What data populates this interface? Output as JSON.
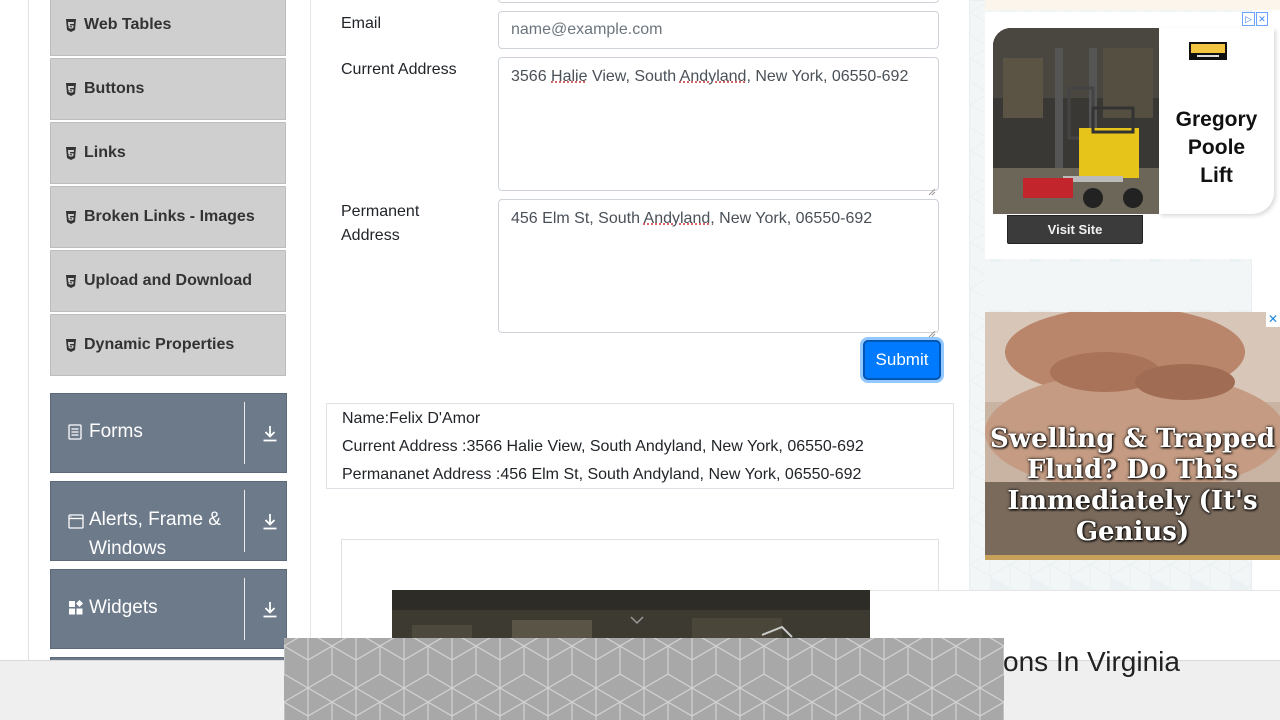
{
  "sidebar": {
    "elements_items": [
      {
        "label": "Web Tables"
      },
      {
        "label": "Buttons"
      },
      {
        "label": "Links"
      },
      {
        "label": "Broken Links - Images"
      },
      {
        "label": "Upload and Download"
      },
      {
        "label": "Dynamic Properties"
      }
    ],
    "groups": [
      {
        "label": "Forms",
        "icon": "form-icon"
      },
      {
        "label_line1": "Alerts, Frame &",
        "label_line2": "Windows",
        "icon": "window-icon"
      },
      {
        "label": "Widgets",
        "icon": "widgets-icon"
      }
    ]
  },
  "form": {
    "email_label": "Email",
    "email_placeholder": "name@example.com",
    "current_address_label": "Current Address",
    "current_address_parts": [
      "3566 ",
      "Halie",
      " View, South ",
      "Andyland,",
      " New York, 06550-692"
    ],
    "permanent_address_label_line1": "Permanent",
    "permanent_address_label_line2": "Address",
    "permanent_address_parts": [
      "456 Elm St, South ",
      "Andyland",
      ", New York, 06550-692"
    ],
    "submit_label": "Submit"
  },
  "output": {
    "name_line": "Name:Felix D'Amor",
    "current_address_line": "Current Address :3566 Halie View, South Andyland, New York, 06550-692",
    "permanent_address_line": "Permananet Address :456 Elm St, South Andyland, New York, 06550-692"
  },
  "ads": {
    "ad1_brand_logo": "Gregory Poole",
    "ad1_brand_line1": "Gregory",
    "ad1_brand_line2": "Poole",
    "ad1_brand_line3": "Lift",
    "ad1_cta": "Visit Site",
    "ad3_headline": "Swelling & Trapped Fluid? Do This Immediately (It's Genius)",
    "sticky_headline": "ons In Virginia"
  },
  "colors": {
    "primary": "#007bff",
    "sidebar_group": "#6c7a8a",
    "sidebar_item": "#cfcfcf"
  }
}
